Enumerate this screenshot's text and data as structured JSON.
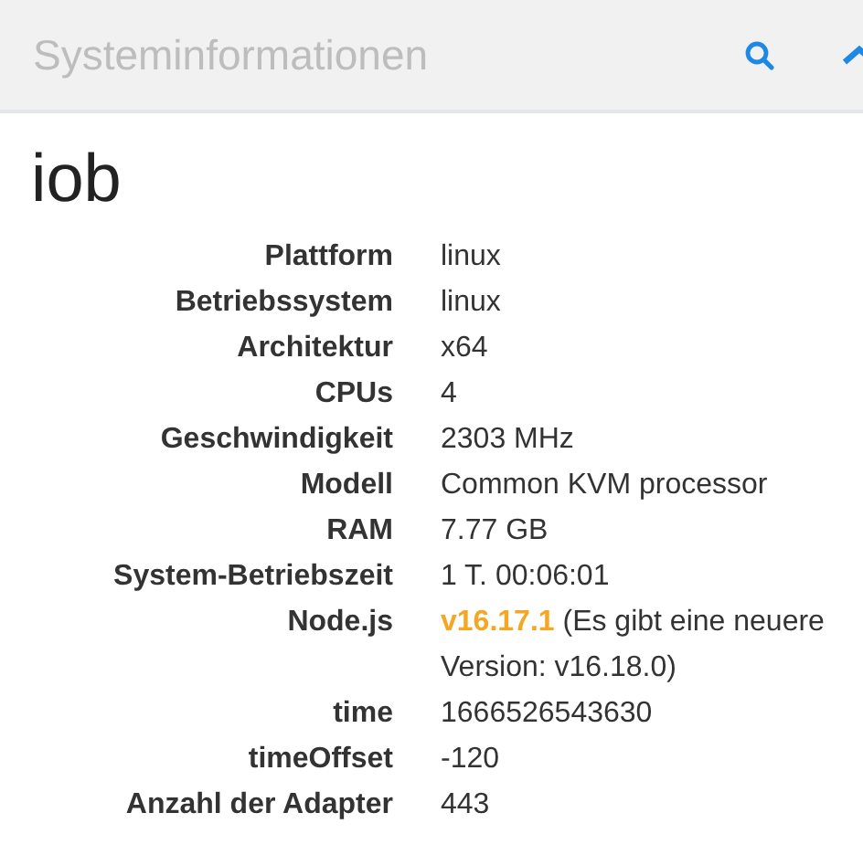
{
  "header": {
    "title": "Systeminformationen"
  },
  "host": "iob",
  "rows": [
    {
      "label": "Plattform",
      "value": "linux"
    },
    {
      "label": "Betriebssystem",
      "value": "linux"
    },
    {
      "label": "Architektur",
      "value": "x64"
    },
    {
      "label": "CPUs",
      "value": "4"
    },
    {
      "label": "Geschwindigkeit",
      "value": "2303 MHz"
    },
    {
      "label": "Modell",
      "value": "Common KVM processor"
    },
    {
      "label": "RAM",
      "value": "7.77 GB"
    },
    {
      "label": "System-Betriebszeit",
      "value": "1 T. 00:06:01"
    },
    {
      "label": "Node.js",
      "value": "v16.17.1",
      "note": "(Es gibt eine neuere Version: v16.18.0)",
      "outdated": true
    },
    {
      "label": "time",
      "value": "1666526543630"
    },
    {
      "label": "timeOffset",
      "value": "-120"
    },
    {
      "label": "Anzahl der Adapter",
      "value": "443"
    }
  ]
}
